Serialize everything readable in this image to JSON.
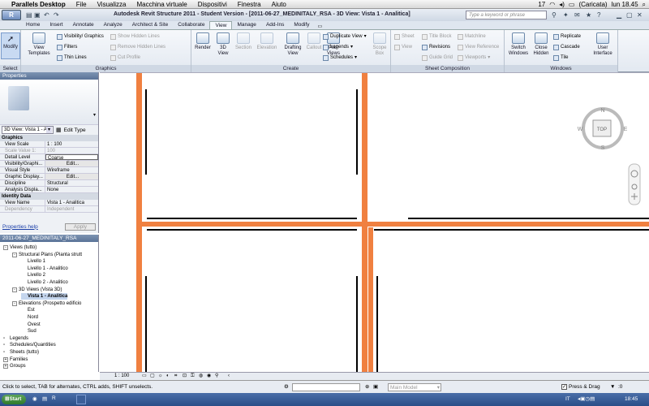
{
  "mac_menubar": {
    "app": "Parallels Desktop",
    "items": [
      "File",
      "Visualizza",
      "Macchina virtuale",
      "Dispositivi",
      "Finestra",
      "Aiuto"
    ],
    "status": [
      "17",
      "(Caricata)",
      "lun 18.45"
    ]
  },
  "window": {
    "title": "Autodesk Revit Structure 2011 - Student Version - [2011-06-27_MEDINITALY_RSA - 3D View: Vista 1 - Analitica]",
    "search_placeholder": "Type a keyword or phrase"
  },
  "ribbon_tabs": [
    "Home",
    "Insert",
    "Annotate",
    "Analyze",
    "Architect & Site",
    "Collaborate",
    "View",
    "Manage",
    "Add-Ins",
    "Modify"
  ],
  "active_tab": "View",
  "ribbon": {
    "modify": "Modify",
    "select_label": "Select",
    "view_templates": "View\nTemplates",
    "visibility_graphics": "Visibility/ Graphics",
    "filters": "Filters",
    "thin_lines": "Thin Lines",
    "show_hidden": "Show Hidden Lines",
    "remove_hidden": "Remove Hidden Lines",
    "cut_profile": "Cut Profile",
    "graphics_label": "Graphics",
    "render": "Render",
    "view3d": "3D\nView",
    "section": "Section",
    "elevation": "Elevation",
    "drafting_view": "Drafting\nView",
    "callout": "Callout",
    "plan_views": "Plan\nViews",
    "duplicate_view": "Duplicate View",
    "legends": "Legends",
    "schedules": "Schedules",
    "scope_box": "Scope\nBox",
    "create_label": "Create",
    "sheet": "Sheet",
    "view": "View",
    "title_block": "Title Block",
    "revisions": "Revisions",
    "guide_grid": "Guide Grid",
    "matchline": "Matchline",
    "view_reference": "View Reference",
    "viewports": "Viewports",
    "sheet_comp_label": "Sheet Composition",
    "switch_windows": "Switch\nWindows",
    "close_hidden": "Close\nHidden",
    "replicate": "Replicate",
    "cascade": "Cascade",
    "tile": "Tile",
    "user_interface": "User\nInterface",
    "windows_label": "Windows"
  },
  "properties": {
    "header": "Properties",
    "type_selector": "3D View: Vista 1 - Ar",
    "edit_type": "Edit Type",
    "sections": [
      {
        "name": "Graphics",
        "rows": [
          {
            "k": "View Scale",
            "v": "1 : 100",
            "dim": false
          },
          {
            "k": "Scale Value  1:",
            "v": "100",
            "dim": true
          },
          {
            "k": "Detail Level",
            "v": "Coarse",
            "dim": false
          },
          {
            "k": "Visibility/Graphi...",
            "v": "Edit...",
            "dim": false
          },
          {
            "k": "Visual Style",
            "v": "Wireframe",
            "dim": false
          },
          {
            "k": "Graphic Display...",
            "v": "Edit...",
            "dim": false
          },
          {
            "k": "Discipline",
            "v": "Structural",
            "dim": false
          },
          {
            "k": "Analysis Displa...",
            "v": "None",
            "dim": false
          }
        ]
      },
      {
        "name": "Identity Data",
        "rows": [
          {
            "k": "View Name",
            "v": "Vista 1 - Analitica",
            "dim": false
          },
          {
            "k": "Dependency",
            "v": "Independent",
            "dim": true
          }
        ]
      }
    ],
    "help_link": "Properties help",
    "apply": "Apply"
  },
  "project_browser": {
    "header": "2011-06-27_MEDINITALY_RSA",
    "nodes": [
      {
        "label": "Views (tutto)",
        "level": 0,
        "toggle": "-",
        "sel": false
      },
      {
        "label": "Structural Plans (Pianta strutt",
        "level": 1,
        "toggle": "-",
        "sel": false
      },
      {
        "label": "Livello 1",
        "level": 2,
        "toggle": "",
        "sel": false
      },
      {
        "label": "Livello 1 - Analitico",
        "level": 2,
        "toggle": "",
        "sel": false
      },
      {
        "label": "Livello 2",
        "level": 2,
        "toggle": "",
        "sel": false
      },
      {
        "label": "Livello 2 - Analitico",
        "level": 2,
        "toggle": "",
        "sel": false
      },
      {
        "label": "3D Views (Vista 3D)",
        "level": 1,
        "toggle": "-",
        "sel": false
      },
      {
        "label": "Vista 1 - Analitica",
        "level": 2,
        "toggle": "",
        "sel": true
      },
      {
        "label": "Elevations (Prospetto edificio",
        "level": 1,
        "toggle": "-",
        "sel": false
      },
      {
        "label": "Est",
        "level": 2,
        "toggle": "",
        "sel": false
      },
      {
        "label": "Nord",
        "level": 2,
        "toggle": "",
        "sel": false
      },
      {
        "label": "Ovest",
        "level": 2,
        "toggle": "",
        "sel": false
      },
      {
        "label": "Sud",
        "level": 2,
        "toggle": "",
        "sel": false
      },
      {
        "label": "Legends",
        "level": 0,
        "toggle": "",
        "sel": false
      },
      {
        "label": "Schedules/Quantities",
        "level": 0,
        "toggle": "",
        "sel": false
      },
      {
        "label": "Sheets (tutto)",
        "level": 0,
        "toggle": "",
        "sel": false
      },
      {
        "label": "Families",
        "level": 0,
        "toggle": "+",
        "sel": false
      },
      {
        "label": "Groups",
        "level": 0,
        "toggle": "+",
        "sel": false
      }
    ]
  },
  "viewcube": {
    "top": "TOP",
    "n": "N",
    "s": "S",
    "e": "E",
    "w": "W"
  },
  "view_control": {
    "scale": "1 : 100"
  },
  "status_bar": {
    "hint": "Click to select, TAB for alternates, CTRL adds, SHIFT unselects.",
    "model": "Main Model",
    "press_drag": "Press & Drag",
    "filter_count": ":0"
  },
  "taskbar": {
    "start": "Start",
    "lang": "IT",
    "time": "18:45"
  },
  "colors": {
    "beam": "#f08040",
    "accent": "#5a7397"
  }
}
